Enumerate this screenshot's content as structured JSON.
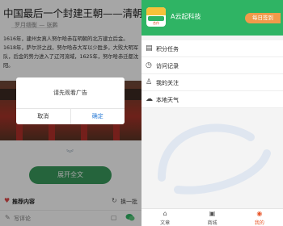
{
  "article": {
    "title": "中国最后一个封建王朝——清朝",
    "author": "罗月缅衡 — 张鹏",
    "body": "1616年，建州女真人努尔哈赤在明朝的北方建立后金。1618年，萨尔浒之战，努尔哈赤大军以少胜多，大败大明军队，后金的势力进入了辽河流域，1625年，努尔哈赤迁都沈阳。",
    "expand_label": "展开全文",
    "recommend_title": "推荐内容",
    "refresh_label": "换一批",
    "comment_placeholder": "写评论"
  },
  "dialog": {
    "message": "请先观看广告",
    "cancel_label": "取消",
    "ok_label": "确定"
  },
  "profile": {
    "avatar_label": "合作",
    "username": "A云起科技",
    "signin_label": "每日签到"
  },
  "menu": {
    "items": [
      {
        "label": "积分任务",
        "icon": "points-icon"
      },
      {
        "label": "访问记录",
        "icon": "history-icon"
      },
      {
        "label": "我的关注",
        "icon": "follow-icon"
      },
      {
        "label": "本地天气",
        "icon": "weather-icon"
      }
    ]
  },
  "nav": {
    "items": [
      {
        "label": "文章",
        "icon": "home-icon",
        "active": false
      },
      {
        "label": "商城",
        "icon": "shop-icon",
        "active": false
      },
      {
        "label": "我的",
        "icon": "user-icon",
        "active": true
      }
    ]
  },
  "colors": {
    "brand_green": "#2fb464",
    "signin_orange": "#f29a4a",
    "active_nav": "#e8562a",
    "dialog_ok": "#2a7bd5"
  }
}
